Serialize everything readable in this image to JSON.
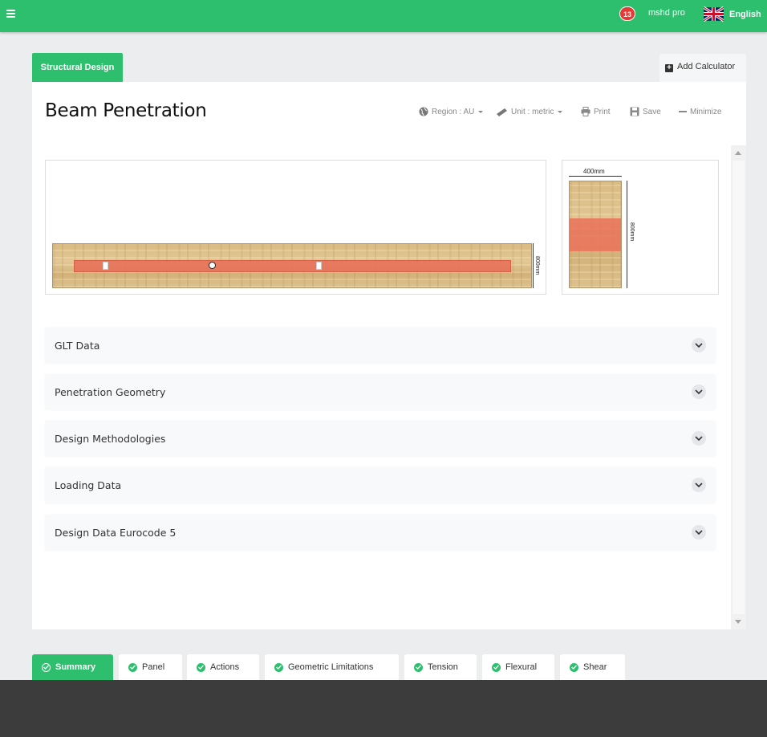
{
  "topbar": {
    "notifications_count": "13",
    "user_name": "mshd pro",
    "language": "English",
    "brand_color": "#2dbf6e"
  },
  "header_tabs": {
    "active_tab": "Structural Design",
    "add_calculator": "Add Calculator"
  },
  "page": {
    "title": "Beam Penetration",
    "toolbar": {
      "region": "Region : AU",
      "unit": "Unit : metric",
      "print": "Print",
      "save": "Save",
      "minimize": "Minimize"
    }
  },
  "diagram": {
    "elevation_depth_label": "800mm",
    "section_width_label": "400mm",
    "section_depth_label": "800mm"
  },
  "accordion": [
    {
      "label": "GLT Data"
    },
    {
      "label": "Penetration Geometry"
    },
    {
      "label": "Design Methodologies"
    },
    {
      "label": "Loading Data"
    },
    {
      "label": "Design Data Eurocode 5"
    }
  ],
  "bottom_tabs": [
    {
      "label": "Summary",
      "active": true
    },
    {
      "label": "Panel"
    },
    {
      "label": "Actions"
    },
    {
      "label": "Geometric Limitations"
    },
    {
      "label": "Tension"
    },
    {
      "label": "Flexural"
    },
    {
      "label": "Shear"
    }
  ]
}
